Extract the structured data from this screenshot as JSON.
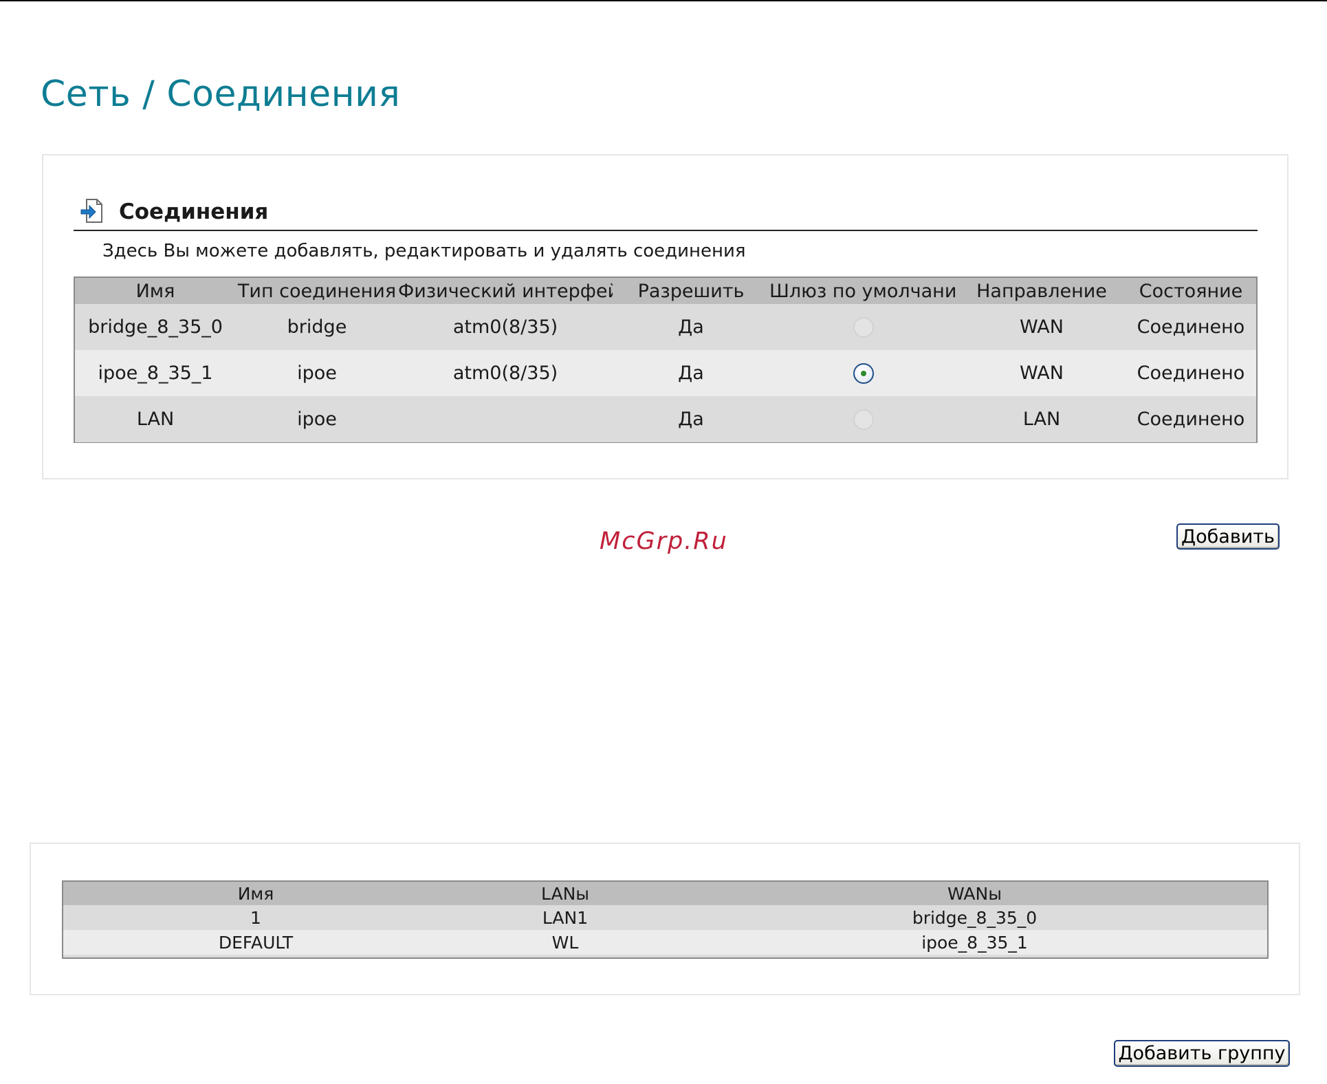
{
  "page": {
    "title": "Сеть / Соединения",
    "watermark": "McGrp.Ru"
  },
  "connections": {
    "icon": "page-arrow-icon",
    "title": "Соединения",
    "description": "Здесь Вы можете добавлять, редактировать и удалять соединения",
    "columns": [
      "Имя",
      "Тип соединения",
      "Физический интерфейс",
      "Разрешить",
      "Шлюз по умолчанию",
      "Направление",
      "Состояние"
    ],
    "rows": [
      {
        "name": "bridge_8_35_0",
        "type": "bridge",
        "iface": "atm0(8/35)",
        "enabled": "Да",
        "gateway": "disabled",
        "direction": "WAN",
        "state": "Соединено"
      },
      {
        "name": "ipoe_8_35_1",
        "type": "ipoe",
        "iface": "atm0(8/35)",
        "enabled": "Да",
        "gateway": "checked",
        "direction": "WAN",
        "state": "Соединено"
      },
      {
        "name": "LAN",
        "type": "ipoe",
        "iface": "",
        "enabled": "Да",
        "gateway": "disabled",
        "direction": "LAN",
        "state": "Соединено"
      }
    ],
    "add_label": "Добавить"
  },
  "groups": {
    "columns": [
      "Имя",
      "LANы",
      "WANы"
    ],
    "rows": [
      {
        "name": "1",
        "lans": "LAN1",
        "wans": "bridge_8_35_0"
      },
      {
        "name": "DEFAULT",
        "lans": "WL",
        "wans": "ipoe_8_35_1"
      }
    ],
    "add_label": "Добавить группу"
  },
  "colors": {
    "title": "#0d7d93",
    "header_bg": "#bdbdbd",
    "row_odd": "#dcdcdc",
    "row_even": "#ececec",
    "button_border": "#1d3f7a",
    "watermark": "#c0203a"
  }
}
